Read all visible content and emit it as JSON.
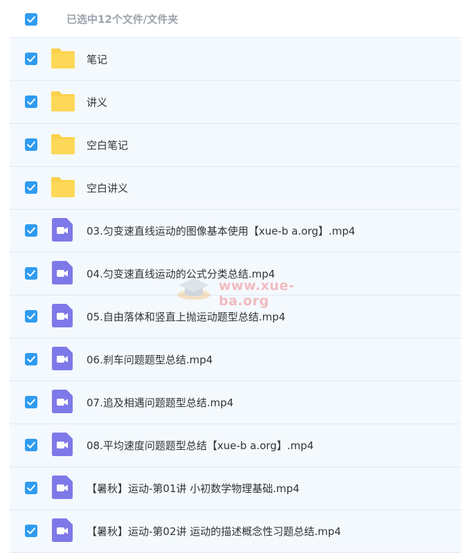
{
  "header": {
    "selection_label": "已选中12个文件/文件夹"
  },
  "colors": {
    "checkbox": "#2f9bf1",
    "folder": "#fcd24c",
    "video": "#7e79e8",
    "row_bg": "#f4f9fe"
  },
  "watermark": {
    "text": "www.xue-ba.org"
  },
  "items": [
    {
      "type": "folder",
      "icon": "folder-icon",
      "name": "笔记",
      "checked": true
    },
    {
      "type": "folder",
      "icon": "folder-icon",
      "name": "讲义",
      "checked": true
    },
    {
      "type": "folder",
      "icon": "folder-icon",
      "name": "空白笔记",
      "checked": true
    },
    {
      "type": "folder",
      "icon": "folder-icon",
      "name": "空白讲义",
      "checked": true
    },
    {
      "type": "video",
      "icon": "video-file-icon",
      "name": "03.匀变速直线运动的图像基本使用【xue-b a.org】.mp4",
      "checked": true
    },
    {
      "type": "video",
      "icon": "video-file-icon",
      "name": "04.匀变速直线运动的公式分类总结.mp4",
      "checked": true
    },
    {
      "type": "video",
      "icon": "video-file-icon",
      "name": "05.自由落体和竖直上抛运动题型总结.mp4",
      "checked": true
    },
    {
      "type": "video",
      "icon": "video-file-icon",
      "name": "06.刹车问题题型总结.mp4",
      "checked": true
    },
    {
      "type": "video",
      "icon": "video-file-icon",
      "name": "07.追及相遇问题题型总结.mp4",
      "checked": true
    },
    {
      "type": "video",
      "icon": "video-file-icon",
      "name": "08.平均速度问题题型总结【xue-b a.org】.mp4",
      "checked": true
    },
    {
      "type": "video",
      "icon": "video-file-icon",
      "name": "【暑秋】运动-第01讲 小初数学物理基础.mp4",
      "checked": true
    },
    {
      "type": "video",
      "icon": "video-file-icon",
      "name": "【暑秋】运动-第02讲 运动的描述概念性习题总结.mp4",
      "checked": true
    }
  ]
}
